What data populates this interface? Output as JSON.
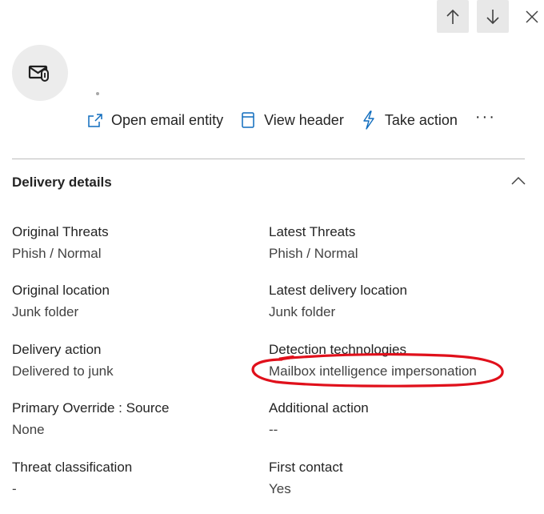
{
  "header": {
    "separator_dot": "."
  },
  "actions": {
    "open_email_entity": "Open email entity",
    "view_header": "View header",
    "take_action": "Take action",
    "more": "···"
  },
  "section": {
    "title": "Delivery details"
  },
  "fields": {
    "original_threats": {
      "label": "Original Threats",
      "value": "Phish / Normal"
    },
    "latest_threats": {
      "label": "Latest Threats",
      "value": "Phish / Normal"
    },
    "original_location": {
      "label": "Original location",
      "value": "Junk folder"
    },
    "latest_delivery_location": {
      "label": "Latest delivery location",
      "value": "Junk folder"
    },
    "delivery_action": {
      "label": "Delivery action",
      "value": "Delivered to junk"
    },
    "detection_technologies": {
      "label": "Detection technologies",
      "value": "Mailbox intelligence impersonation"
    },
    "primary_override": {
      "label": "Primary Override : Source",
      "value": "None"
    },
    "additional_action": {
      "label": "Additional action",
      "value": "--"
    },
    "threat_classification": {
      "label": "Threat classification",
      "value": "-"
    },
    "first_contact": {
      "label": "First contact",
      "value": "Yes"
    }
  },
  "icons": {
    "nav_up": "arrow-up-icon",
    "nav_down": "arrow-down-icon",
    "close": "close-icon",
    "avatar": "email-attachment-icon",
    "open_email": "open-external-icon",
    "view_header": "document-header-icon",
    "take_action": "lightning-icon",
    "collapse": "chevron-up-icon"
  },
  "colors": {
    "accent": "#0f6cbd",
    "annotation": "#e0101b"
  }
}
